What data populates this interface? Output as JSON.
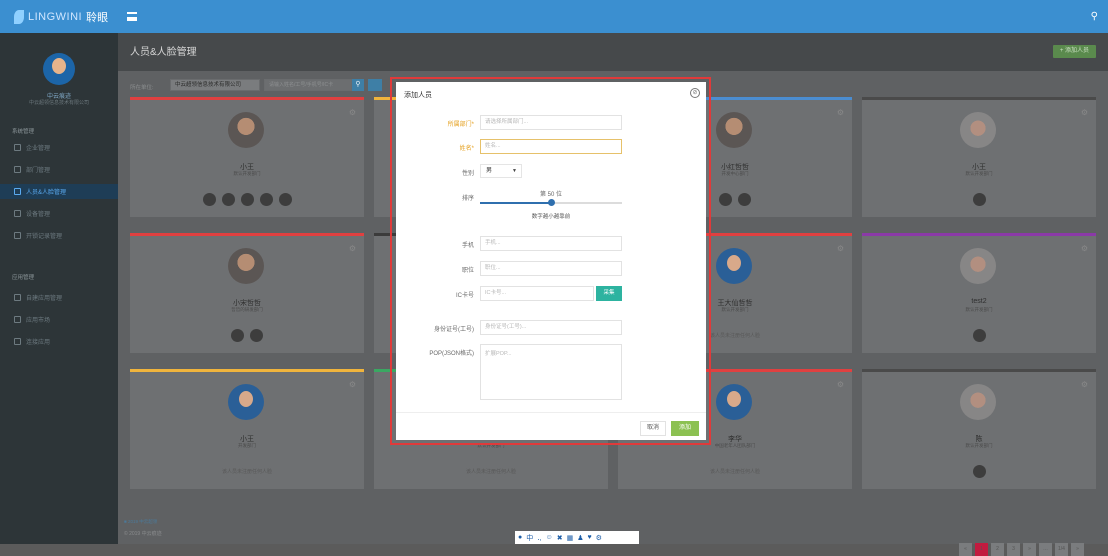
{
  "app": {
    "brand": "LINGWINI",
    "logo_text": "聆眼"
  },
  "sidebar": {
    "user_name": "中云痕迹",
    "org": "中云超领信息技术有限公司",
    "group1": "系统管理",
    "items": [
      {
        "label": "企业管理"
      },
      {
        "label": "部门管理"
      },
      {
        "label": "人员&人脸管理",
        "active": true
      },
      {
        "label": "设备管理"
      },
      {
        "label": "开锁记录管理"
      }
    ],
    "group2": "应用管理",
    "items2": [
      {
        "label": "自建应用管理"
      },
      {
        "label": "应用市场"
      },
      {
        "label": "连接应用"
      }
    ]
  },
  "main": {
    "title": "人员&人脸管理",
    "add_button": "+ 添加人员",
    "filter_label": "所在单位:",
    "filter_company": "中云超领信息技术有限公司",
    "search_placeholder": "请输入姓名/工号/手机号/IC卡",
    "cards": [
      {
        "name": "小王",
        "dept": "默认开发部门",
        "face": "real",
        "color": "#e04040",
        "thumbs": 5
      },
      {
        "name": "",
        "dept": "",
        "face": "none",
        "color": "#f0b43c",
        "thumbs": 0
      },
      {
        "name": "小红哲哲",
        "dept": "开发中心部门",
        "face": "real",
        "color": "#4b8dd1",
        "thumbs": 2
      },
      {
        "name": "小王",
        "dept": "默认开发部门",
        "face": "light",
        "color": "#4a4a4a",
        "thumbs": 1
      },
      {
        "name": "小宋哲哲",
        "dept": "哲哲的研发部门",
        "face": "real",
        "color": "#e04040",
        "thumbs": 2
      },
      {
        "name": "",
        "dept": "",
        "face": "none",
        "color": "#3b3b3b",
        "thumbs": 0
      },
      {
        "name": "王大仙哲哲",
        "dept": "默认开发部门",
        "face": "blue",
        "color": "#e04040",
        "empty": "该人员未注册任何人脸"
      },
      {
        "name": "test2",
        "dept": "默认开发部门",
        "face": "light",
        "color": "#8b3aa8",
        "thumbs": 1
      },
      {
        "name": "小王",
        "dept": "开发部门",
        "face": "blue",
        "color": "#f0b43c",
        "empty": "该人员未注册任何人脸"
      },
      {
        "name": "",
        "dept": "默认开发部门",
        "face": "none",
        "color": "#3aa862",
        "empty": "该人员未注册任何人脸"
      },
      {
        "name": "李华",
        "dept": "中国老年人团队部门",
        "face": "blue",
        "color": "#e04040",
        "empty": "该人员未注册任何人脸"
      },
      {
        "name": "陈",
        "dept": "默认开发部门",
        "face": "light",
        "color": "#4a4a4a",
        "thumbs": 1
      }
    ],
    "footer_link": "■ 2019 中云超领",
    "copyright": "© 2019 中云痕迹",
    "pager": [
      "«",
      "1",
      "2",
      "3",
      "»",
      "…",
      "1/4",
      "»"
    ]
  },
  "modal": {
    "title": "添加人员",
    "dept_label": "所属部门*",
    "dept_placeholder": "请选择所属部门...",
    "name_label": "姓名*",
    "name_placeholder": "姓名...",
    "gender_label": "性别",
    "gender_value": "男",
    "rank_label": "排序",
    "rank_value_text": "第 50 位",
    "rank_value": 0.5,
    "rank_hint": "数字越小越靠前",
    "phone_label": "手机",
    "phone_placeholder": "手机...",
    "position_label": "职位",
    "position_placeholder": "职位...",
    "ic_label": "IC卡号",
    "ic_placeholder": "IC卡号...",
    "collect_button": "采集",
    "id_label": "身份证号(工号)",
    "id_placeholder": "身份证号(工号)...",
    "pop_label": "POP(JSON格式)",
    "pop_placeholder": "扩展POP...",
    "cancel_button": "取消",
    "submit_button": "添加"
  }
}
